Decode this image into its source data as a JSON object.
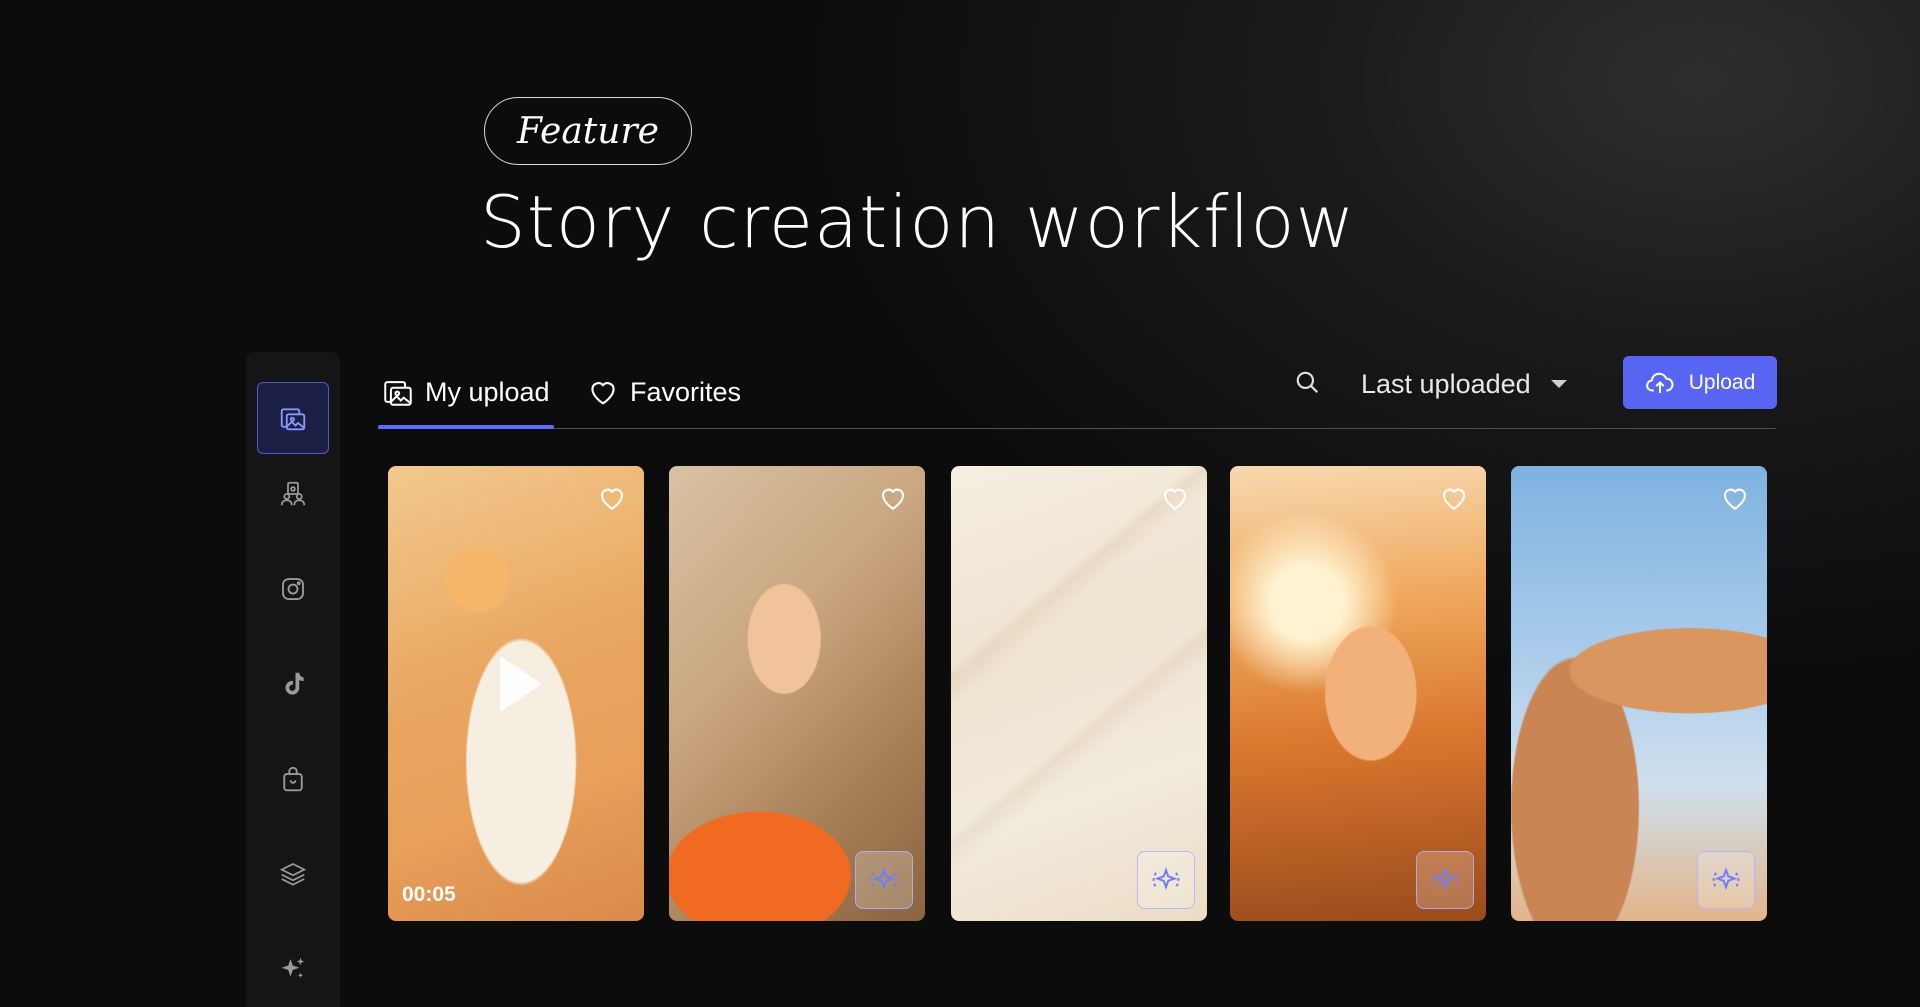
{
  "hero": {
    "badge": "Feature",
    "title": "Story creation workflow"
  },
  "sidebar": {
    "items": [
      {
        "name": "media-library",
        "icon": "gallery-icon",
        "active": true
      },
      {
        "name": "creators",
        "icon": "users-icon"
      },
      {
        "name": "instagram",
        "icon": "instagram-icon"
      },
      {
        "name": "tiktok",
        "icon": "tiktok-icon"
      },
      {
        "name": "shop",
        "icon": "shopping-bag-icon"
      },
      {
        "name": "layers",
        "icon": "layers-icon"
      },
      {
        "name": "ai",
        "icon": "sparkles-icon"
      }
    ]
  },
  "tabs": [
    {
      "label": "My upload",
      "icon": "gallery-icon",
      "active": true
    },
    {
      "label": "Favorites",
      "icon": "heart-icon"
    }
  ],
  "sort": {
    "label": "Last uploaded"
  },
  "upload_button": {
    "label": "Upload",
    "icon": "cloud-upload-icon"
  },
  "media": [
    {
      "type": "video",
      "duration": "00:05",
      "description": "sunscreen product video"
    },
    {
      "type": "image",
      "description": "woman sunbathing orange swimsuit"
    },
    {
      "type": "image",
      "description": "cream texture"
    },
    {
      "type": "image",
      "description": "woman in sunlight"
    },
    {
      "type": "image",
      "description": "tanned legs against sky"
    }
  ],
  "colors": {
    "accent": "#5865f2",
    "background": "#0c0c0d",
    "sidebar": "#151517"
  }
}
